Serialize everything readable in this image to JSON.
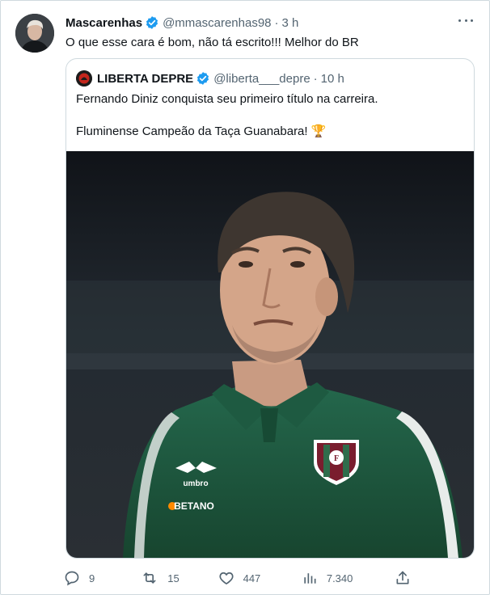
{
  "tweet": {
    "author_name": "Mascarenhas",
    "handle": "@mmascarenhas98",
    "separator": "·",
    "time": "3 h",
    "text": "O que esse cara é bom, não tá escrito!!! Melhor do BR"
  },
  "quote": {
    "author_name": "LIBERTA DEPRE",
    "handle": "@liberta___depre",
    "separator": "·",
    "time": "10 h",
    "line1": "Fernando Diniz conquista seu primeiro título na carreira.",
    "line2": "Fluminense Campeão da Taça Guanabara! 🏆",
    "image": {
      "shirt_brand": "umbro",
      "sponsor": "BETANO"
    }
  },
  "actions": {
    "replies": "9",
    "retweets": "15",
    "likes": "447",
    "views": "7.340"
  },
  "icons": {
    "verified": "verified-badge-icon",
    "more": "more-options-icon",
    "reply": "reply-icon",
    "retweet": "retweet-icon",
    "like": "heart-icon",
    "views": "views-icon",
    "share": "share-icon"
  },
  "colors": {
    "verified_blue": "#1d9bf0",
    "muted_text": "#536471",
    "border": "#cfd9de",
    "shirt_green": "#1f5c44"
  }
}
